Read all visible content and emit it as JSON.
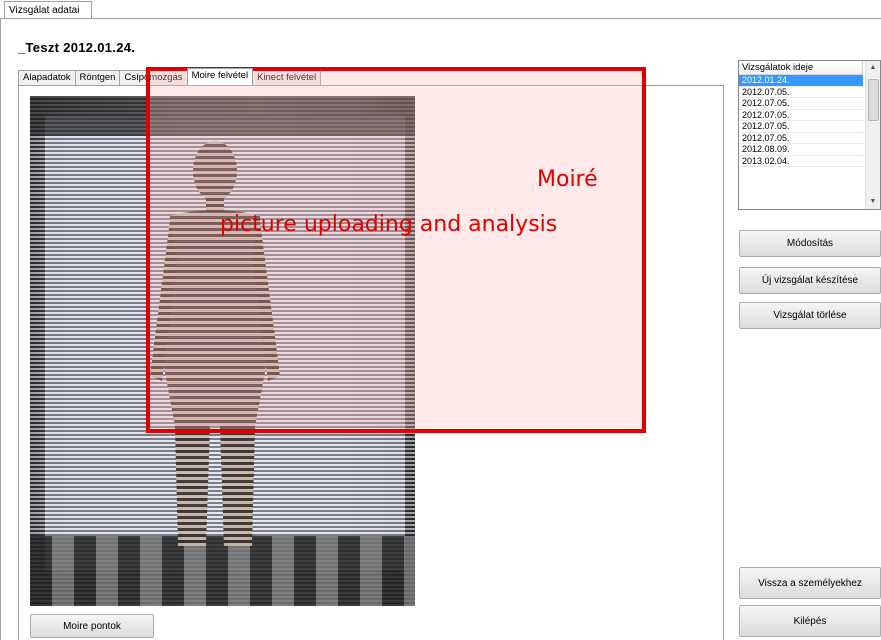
{
  "window": {
    "outer_tab": "Vizsgálat adatai"
  },
  "header": {
    "title": "_Teszt  2012.01.24."
  },
  "tabs": [
    {
      "label": "Alapadatok"
    },
    {
      "label": "Röntgen"
    },
    {
      "label": "Csípőmozgás"
    },
    {
      "label": "Moire felvétel"
    },
    {
      "label": "Kinect felvétel"
    }
  ],
  "active_tab": "Moire felvétel",
  "main": {
    "moire_points_button": "Moire pontok"
  },
  "exam_list": {
    "header": "Vizsgálatok ideje",
    "rows": [
      "2012.01.24.",
      "2012.07.05.",
      "2012.07.05.",
      "2012.07.05.",
      "2012.07.05.",
      "2012.07.05.",
      "2012.08.09.",
      "2013.02.04."
    ],
    "selected_index": 0
  },
  "buttons": {
    "modify": "Módosítás",
    "new_exam": "Új vizsgálat készítése",
    "delete_exam": "Vizsgálat törlése",
    "back_to_people": "Vissza a személyekhez",
    "exit": "Kilépés"
  },
  "annotation": {
    "line1": "Moiré",
    "line2": "picture uploading and analysis",
    "color": "#e00000"
  }
}
